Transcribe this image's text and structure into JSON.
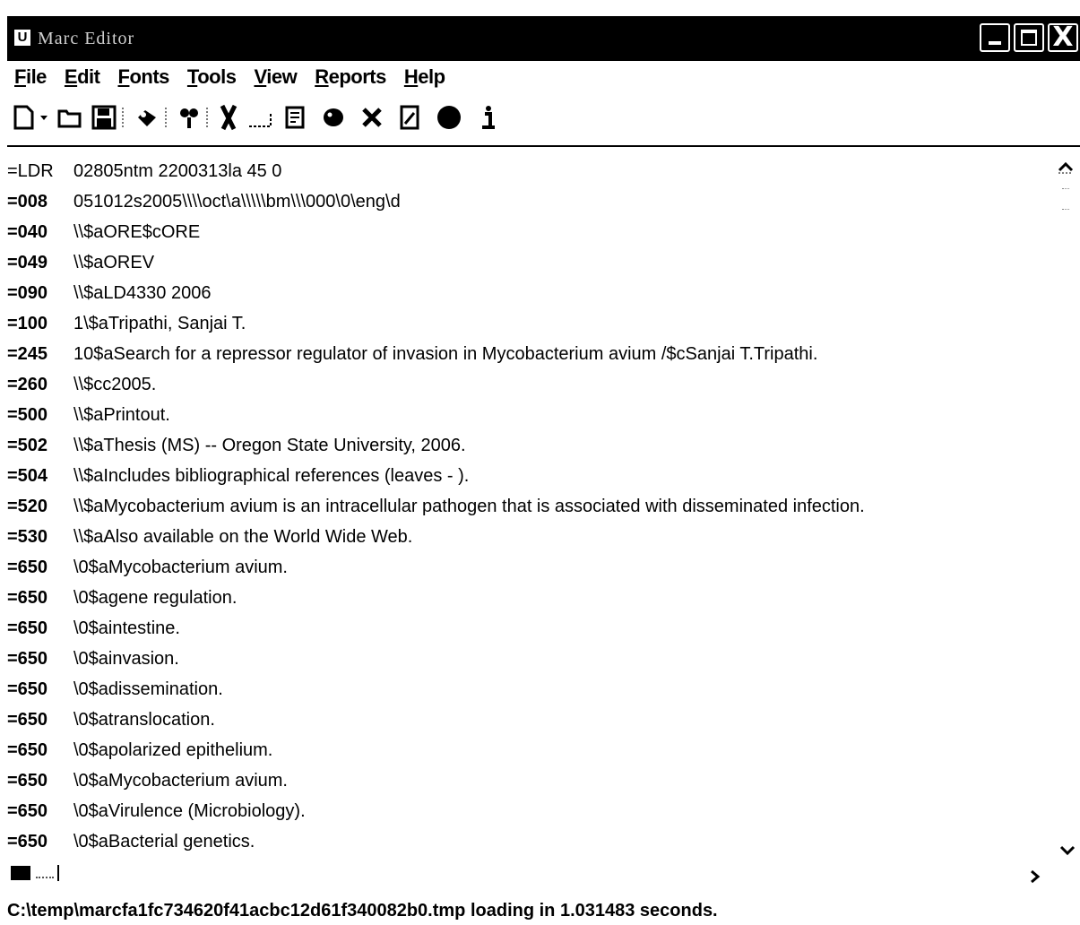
{
  "window": {
    "title": "Marc Editor",
    "app_icon": "app-icon",
    "controls": {
      "minimize_icon": "minimize-icon",
      "maximize_icon": "maximize-icon",
      "close_icon": "close-icon",
      "close_glyph": "X"
    }
  },
  "menu": {
    "file": {
      "mnemonic": "F",
      "rest": "ile"
    },
    "edit": {
      "mnemonic": "E",
      "rest": "dit"
    },
    "fonts": {
      "mnemonic": "F",
      "rest": "onts"
    },
    "tools": {
      "mnemonic": "T",
      "rest": "ools"
    },
    "view": {
      "mnemonic": "V",
      "rest": "iew"
    },
    "reports": {
      "mnemonic": "R",
      "rest": "eports"
    },
    "help": {
      "mnemonic": "H",
      "rest": "elp"
    }
  },
  "toolbar": {
    "icons": [
      "new-document-icon",
      "dropdown-arrow-icon",
      "open-folder-icon",
      "save-icon",
      "print-icon",
      "find-icon",
      "cut-icon",
      "copy-icon",
      "paste-icon",
      "validate-icon",
      "delete-icon",
      "edit-record-icon",
      "compile-icon",
      "info-icon"
    ]
  },
  "record": {
    "lines": [
      {
        "tag": "=LDR",
        "value": "02805ntm  2200313la 45 0"
      },
      {
        "tag": "=008",
        "value": "051012s2005\\\\\\\\oct\\a\\\\\\\\\\bm\\\\\\000\\0\\eng\\d"
      },
      {
        "tag": "=040",
        "value": "\\\\$aORE$cORE"
      },
      {
        "tag": "=049",
        "value": "\\\\$aOREV"
      },
      {
        "tag": "=090",
        "value": "\\\\$aLD4330 2006"
      },
      {
        "tag": "=100",
        "value": "1\\$aTripathi, Sanjai T."
      },
      {
        "tag": "=245",
        "value": "10$aSearch for a repressor regulator of invasion in Mycobacterium avium /$cSanjai T.Tripathi."
      },
      {
        "tag": "=260",
        "value": "\\\\$cc2005."
      },
      {
        "tag": "=500",
        "value": "\\\\$aPrintout."
      },
      {
        "tag": "=502",
        "value": "\\\\$aThesis (MS) -- Oregon State University, 2006."
      },
      {
        "tag": "=504",
        "value": "\\\\$aIncludes bibliographical references (leaves - )."
      },
      {
        "tag": "=520",
        "value": "\\\\$aMycobacterium avium is an intracellular pathogen that is associated with disseminated infection."
      },
      {
        "tag": "=530",
        "value": "\\\\$aAlso available on the World Wide Web."
      },
      {
        "tag": "=650",
        "value": "\\0$aMycobacterium avium."
      },
      {
        "tag": "=650",
        "value": "\\0$agene regulation."
      },
      {
        "tag": "=650",
        "value": "\\0$aintestine."
      },
      {
        "tag": "=650",
        "value": "\\0$ainvasion."
      },
      {
        "tag": "=650",
        "value": "\\0$adissemination."
      },
      {
        "tag": "=650",
        "value": "\\0$atranslocation."
      },
      {
        "tag": "=650",
        "value": "\\0$apolarized epithelium."
      },
      {
        "tag": "=650",
        "value": "\\0$aMycobacterium avium."
      },
      {
        "tag": "=650",
        "value": "\\0$aVirulence (Microbiology)."
      },
      {
        "tag": "=650",
        "value": "\\0$aBacterial genetics."
      }
    ]
  },
  "scrollbars": {
    "up_icon": "scroll-up-icon",
    "down_icon": "scroll-down-icon",
    "right_icon": "scroll-right-icon",
    "left_icon": "scroll-left-icon"
  },
  "status": {
    "text": "C:\\temp\\marcfa1fc734620f41acbc12d61f340082b0.tmp loading in 1.031483 seconds."
  }
}
